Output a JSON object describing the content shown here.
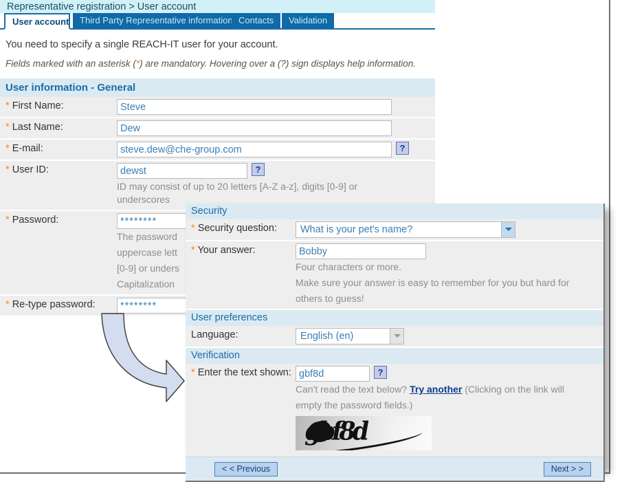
{
  "breadcrumb": "Representative registration > User account",
  "tabs": [
    {
      "label": "User account",
      "active": true
    },
    {
      "label": "Third Party Representative information",
      "active": false
    },
    {
      "label": "Contacts",
      "active": false
    },
    {
      "label": "Validation",
      "active": false
    }
  ],
  "intro": {
    "line1": "You need to specify a single REACH-IT user for your account.",
    "note_pre": "Fields marked with an asterisk (",
    "note_ast": "*",
    "note_post": ") are mandatory. Hovering over a (?) sign displays help information."
  },
  "sections": {
    "general": {
      "title": "User information - General",
      "first_name": {
        "label": "First Name:",
        "value": "Steve",
        "required": true
      },
      "last_name": {
        "label": "Last Name:",
        "value": "Dew",
        "required": true
      },
      "email": {
        "label": "E-mail:",
        "value": "steve.dew@che-group.com",
        "required": true,
        "help": "?"
      },
      "user_id": {
        "label": "User ID:",
        "value": "dewst",
        "required": true,
        "help": "?",
        "hint": "ID may consist of up to 20 letters [A-Z a-z], digits [0-9] or underscores"
      },
      "password": {
        "label": "Password:",
        "value": "********",
        "required": true,
        "hint_line1": "The password",
        "hint_line2": "uppercase lett",
        "hint_line3": "[0-9] or unders",
        "hint_line4": "Capitalization"
      },
      "retype_password": {
        "label": "Re-type password:",
        "value": "********",
        "required": true
      }
    },
    "security": {
      "title": "Security",
      "question": {
        "label": "Security question:",
        "value": "What is your pet's name?",
        "required": true
      },
      "answer": {
        "label": "Your answer:",
        "value": "Bobby",
        "required": true,
        "hint_line1": "Four characters or more.",
        "hint_line2": "Make sure your answer is easy to remember for you but hard for",
        "hint_line3": "others to guess!"
      }
    },
    "preferences": {
      "title": "User preferences",
      "language": {
        "label": "Language:",
        "value": "English (en)",
        "required": false
      }
    },
    "verification": {
      "title": "Verification",
      "captcha_field": {
        "label": "Enter the text shown:",
        "value": "gbf8d",
        "required": true,
        "help": "?"
      },
      "hint_pre": "Can't read the text below? ",
      "hint_link": "Try another",
      "hint_post": " (Clicking on the link will",
      "hint_line2": "empty the password fields.)",
      "captcha_image_text": "gbf8d"
    }
  },
  "footer": {
    "previous_label": "< < Previous",
    "next_label": "Next > >"
  },
  "colors": {
    "accent_blue": "#1a6ca8",
    "tab_blue": "#0e6aa8",
    "breadcrumb_bg": "#d2f0f7",
    "section_bg": "#dbeaf2",
    "row_bg": "#eeeeee",
    "field_text": "#3a7fb5",
    "required_ast": "#ef8a2b",
    "footer_bg": "#dce9f2",
    "arrow_fill": "#d4dcf0"
  }
}
